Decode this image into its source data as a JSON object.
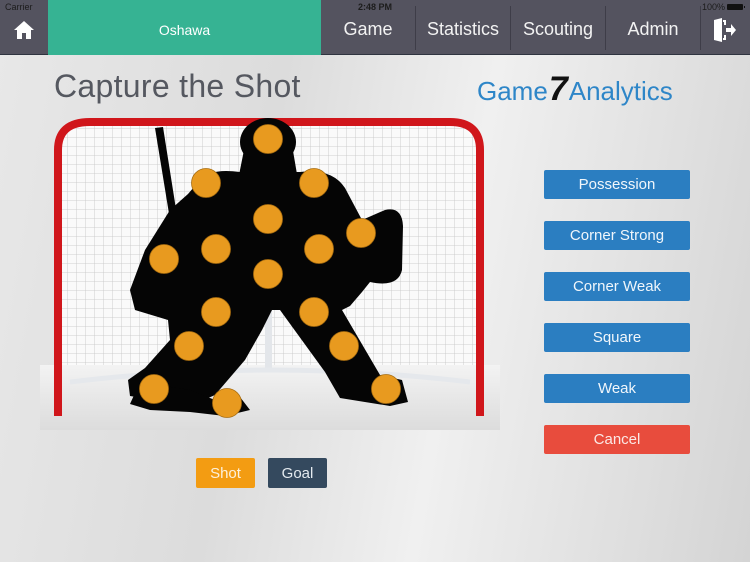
{
  "status_bar": {
    "carrier": "Carrier",
    "time": "2:48 PM",
    "battery": "100%"
  },
  "nav": {
    "home_icon": "home-icon",
    "team": "Oshawa",
    "items": [
      {
        "label": "Game"
      },
      {
        "label": "Statistics"
      },
      {
        "label": "Scouting"
      },
      {
        "label": "Admin"
      }
    ],
    "logout_icon": "logout-icon"
  },
  "page": {
    "title": "Capture the Shot",
    "brand": {
      "part1": "Game",
      "part2": "7",
      "part3": "Analytics"
    }
  },
  "shot_zones": [
    {
      "id": "head"
    },
    {
      "id": "left-shoulder"
    },
    {
      "id": "right-shoulder"
    },
    {
      "id": "chest"
    },
    {
      "id": "glove"
    },
    {
      "id": "blocker-side"
    },
    {
      "id": "right-chest"
    },
    {
      "id": "blocker"
    },
    {
      "id": "belly"
    },
    {
      "id": "left-thigh"
    },
    {
      "id": "right-thigh"
    },
    {
      "id": "left-knee"
    },
    {
      "id": "right-knee"
    },
    {
      "id": "left-skate"
    },
    {
      "id": "right-skate"
    },
    {
      "id": "stick"
    }
  ],
  "zone_buttons": [
    {
      "label": "Possession"
    },
    {
      "label": "Corner Strong"
    },
    {
      "label": "Corner Weak"
    },
    {
      "label": "Square"
    },
    {
      "label": "Weak"
    }
  ],
  "cancel_label": "Cancel",
  "shot_label": "Shot",
  "goal_label": "Goal",
  "colors": {
    "nav_bg": "#54535f",
    "team_tab": "#36b393",
    "zone_button": "#2b7ec1",
    "cancel": "#e84c3d",
    "shot": "#f39c12",
    "goal": "#34495e",
    "spot": "#e89a1f",
    "net_frame": "#d0161b"
  }
}
